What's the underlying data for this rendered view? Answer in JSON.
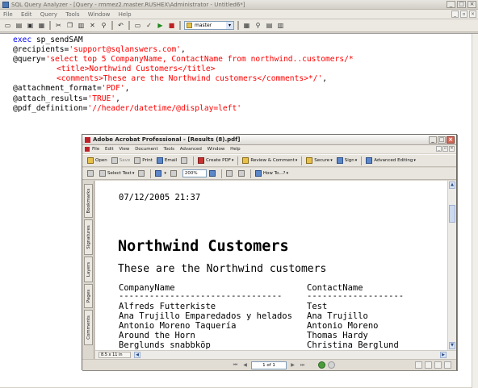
{
  "window": {
    "title": "SQL Query Analyzer - [Query - rmmez2.master.RUSHEX\\Administrator - Untitled6*]",
    "controls": [
      "_",
      "□",
      "×"
    ]
  },
  "menu": [
    "File",
    "Edit",
    "Query",
    "Tools",
    "Window",
    "Help"
  ],
  "toolbar": {
    "database": "master"
  },
  "editor": {
    "line1_kw": "exec",
    "line1_rest": " sp_sendSAM",
    "line2_param": "@recipients=",
    "line2_val": "'support@sqlanswers.com'",
    "line2_end": ",",
    "line3_param": "@query=",
    "line3_val": "'select top 5 CompanyName, ContactName from northwind..customers/*",
    "line4": "<title>Northwind Customers</title>",
    "line5": "<comments>These are the Northwind customers</comments>*/'",
    "line5_end": ",",
    "line6_param": "@attachment_format=",
    "line6_val": "'PDF'",
    "line6_end": ",",
    "line7_param": "@attach_results=",
    "line7_val": "'TRUE'",
    "line7_end": ",",
    "line8_param": "@pdf_definition=",
    "line8_val": "'//header/datetime/@display=left'"
  },
  "acrobat": {
    "title": "Adobe Acrobat Professional - [Results (8).pdf]",
    "menu": [
      "File",
      "Edit",
      "View",
      "Document",
      "Tools",
      "Advanced",
      "Window",
      "Help"
    ],
    "toolbar1": {
      "open": "Open",
      "save": "Save",
      "print": "Print",
      "email": "Email",
      "create_pdf": "Create PDF",
      "review": "Review & Comment",
      "secure": "Secure",
      "sign": "Sign",
      "advanced_editing": "Advanced Editing"
    },
    "toolbar2": {
      "select_text": "Select Text",
      "zoom": "200%",
      "howto": "How To...?"
    },
    "nav_tabs": [
      "Bookmarks",
      "Signatures",
      "Layers",
      "Pages",
      "Comments"
    ],
    "document": {
      "datetime": "07/12/2005 21:37",
      "heading": "Northwind Customers",
      "subheading": "These are the Northwind customers",
      "columns": [
        "CompanyName",
        "ContactName"
      ],
      "rule1": "--------------------------------",
      "rule2": "-------------------",
      "rows": [
        [
          "Alfreds Futterkiste",
          "Test"
        ],
        [
          "Ana Trujillo Emparedados y helados",
          "Ana Trujillo"
        ],
        [
          "Antonio Moreno Taquería",
          "Antonio Moreno"
        ],
        [
          "Around the Horn",
          "Thomas Hardy"
        ],
        [
          "Berglunds snabbköp",
          "Christina Berglund"
        ]
      ]
    },
    "page_size": "8.5 x 11 in",
    "page_indicator": "1 of 1"
  }
}
